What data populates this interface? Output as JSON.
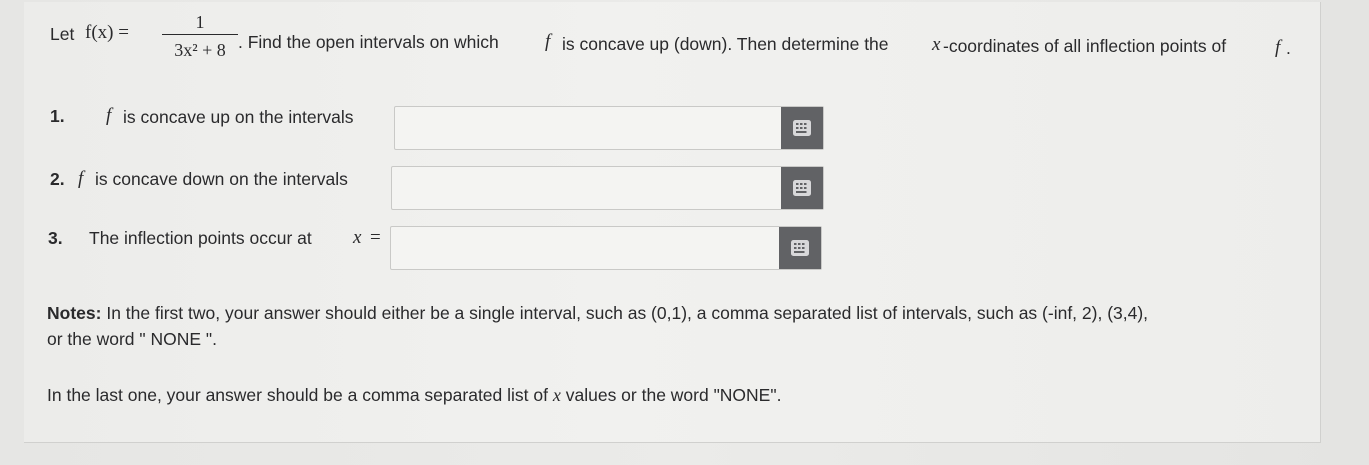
{
  "problem": {
    "let_text": "Let",
    "function_lhs": "f(x) =",
    "fraction_numerator": "1",
    "fraction_denominator": "3x² + 8",
    "text_part1": ". Find the open intervals on which",
    "f_symbol": "f",
    "text_part2": "is concave up (down). Then determine the",
    "x_symbol": "x",
    "text_part3": "-coordinates of all inflection points of",
    "f_end": "f",
    "period": "."
  },
  "questions": [
    {
      "number": "1.",
      "f_symbol": "f",
      "text": "is concave up on the intervals",
      "value": "",
      "placeholder": ""
    },
    {
      "number": "2.",
      "f_symbol": "f",
      "text": "is concave down on the intervals",
      "value": "",
      "placeholder": ""
    },
    {
      "number": "3.",
      "text": "The inflection points occur at",
      "x_symbol": "x",
      "equals": "=",
      "value": "",
      "placeholder": ""
    }
  ],
  "notes": {
    "label": "Notes:",
    "line1": "In the first two, your answer should either be a single interval, such as (0,1), a comma separated list of intervals, such as (-inf, 2), (3,4),",
    "line2": "or the word \" NONE \".",
    "last_pre": "In the last one, your answer should be a comma separated list of",
    "last_x": "x",
    "last_post": "values or the word \"NONE\"."
  },
  "icons": {
    "keypad": "keypad-icon"
  },
  "colors": {
    "keypad_button": "#616265",
    "card_background": "#f0f0ee",
    "text": "#2a2a2c"
  }
}
